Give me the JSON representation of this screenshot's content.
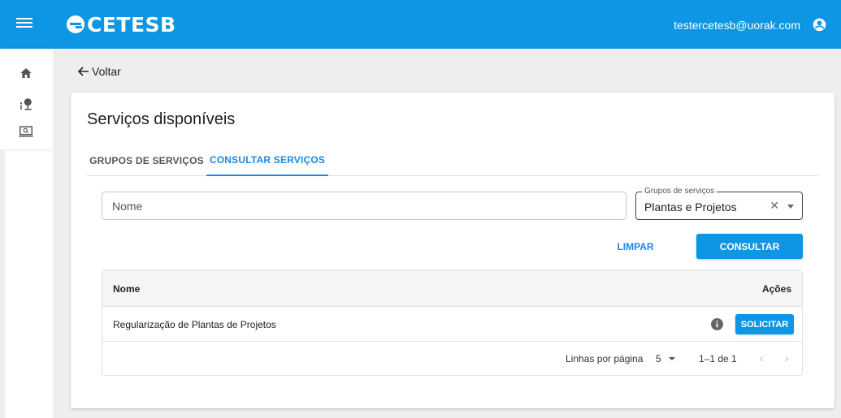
{
  "header": {
    "logo_text": "CETESB",
    "user_email": "testercetesb@uorak.com"
  },
  "sidebar": {
    "items": [
      {
        "icon": "home-icon"
      },
      {
        "icon": "tree-info-icon"
      },
      {
        "icon": "monitor-search-icon"
      }
    ]
  },
  "nav": {
    "back_label": "Voltar"
  },
  "page": {
    "title": "Serviços disponíveis",
    "tabs": [
      {
        "label": "GRUPOS DE SERVIÇOS",
        "active": false
      },
      {
        "label": "CONSULTAR SERVIÇOS",
        "active": true
      }
    ]
  },
  "filters": {
    "name_placeholder": "Nome",
    "group_label": "Grupos de serviços",
    "group_value": "Plantas e Projetos",
    "clear_label": "LIMPAR",
    "search_label": "CONSULTAR"
  },
  "table": {
    "headers": {
      "name": "Nome",
      "actions": "Ações"
    },
    "rows": [
      {
        "name": "Regularização de Plantas de Projetos",
        "action_label": "SOLICITAR"
      }
    ]
  },
  "pagination": {
    "rows_per_page_label": "Linhas por página",
    "rows_per_page": "5",
    "range": "1–1 de 1"
  },
  "colors": {
    "primary": "#0d96e3",
    "tab_active": "#1e88e5",
    "background": "#eeeeee"
  }
}
